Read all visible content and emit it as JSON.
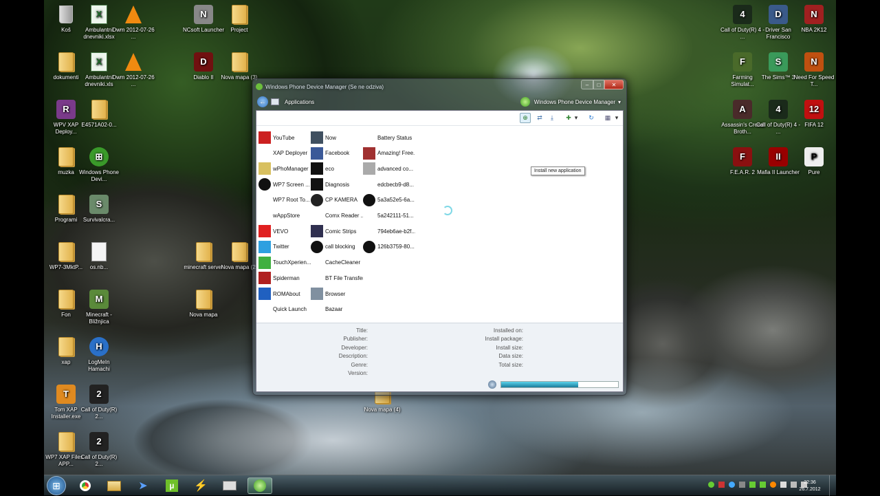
{
  "desktop_icons": [
    {
      "label": "Koš",
      "icon": "recycle-bin-icon"
    },
    {
      "label": "Ambulantni dnevniki.xlsx",
      "icon": "excel-file-icon"
    },
    {
      "label": "Dwm 2012-07-26 ...",
      "icon": "vlc-cone-icon"
    },
    {
      "label": "NCsoft Launcher",
      "icon": "ncsoft-icon"
    },
    {
      "label": "Project",
      "icon": "folder-icon"
    },
    {
      "label": "dokumenti",
      "icon": "folder-icon"
    },
    {
      "label": "Ambulantni dnevniki.xls",
      "icon": "excel-file-icon"
    },
    {
      "label": "Dwm 2012-07-26 ...",
      "icon": "vlc-cone-icon"
    },
    {
      "label": "Diablo II",
      "icon": "diablo-icon"
    },
    {
      "label": "Nova mapa (3)",
      "icon": "folder-icon"
    },
    {
      "label": "WPV XAP Deploy...",
      "icon": "winrar-icon"
    },
    {
      "label": "E4571A02-0...",
      "icon": "folder-icon"
    },
    {
      "label": "muzka",
      "icon": "folder-icon"
    },
    {
      "label": "Windows Phone Devi...",
      "icon": "windows-phone-icon"
    },
    {
      "label": "Programi",
      "icon": "folder-icon"
    },
    {
      "label": "Survivalcra...",
      "icon": "survivalcraft-icon"
    },
    {
      "label": "WP7-3MktP...",
      "icon": "folder-icon"
    },
    {
      "label": "os.nb...",
      "icon": "file-icon"
    },
    {
      "label": "minecraft server",
      "icon": "folder-icon"
    },
    {
      "label": "Nova mapa (2)",
      "icon": "folder-icon"
    },
    {
      "label": "Fon",
      "icon": "folder-icon"
    },
    {
      "label": "Minecraft - Bližnjica",
      "icon": "minecraft-icon"
    },
    {
      "label": "Nova mapa",
      "icon": "folder-icon"
    },
    {
      "label": "xap",
      "icon": "folder-icon"
    },
    {
      "label": "LogMeIn Hamachi",
      "icon": "hamachi-icon"
    },
    {
      "label": "Tom XAP Installer.exe",
      "icon": "installer-icon"
    },
    {
      "label": "Call of Duty(R) 2...",
      "icon": "cod2-icon"
    },
    {
      "label": "WP7 XAP Files - APP...",
      "icon": "folder-icon"
    },
    {
      "label": "Call of Duty(R) 2...",
      "icon": "cod2-icon"
    },
    {
      "label": "Nova mapa (4)",
      "icon": "folder-icon"
    },
    {
      "label": "Call of Duty(R) 4 - ...",
      "icon": "cod4-icon"
    },
    {
      "label": "Driver San Francisco",
      "icon": "driver-icon"
    },
    {
      "label": "NBA 2K12",
      "icon": "nba-icon"
    },
    {
      "label": "Farming Simulat...",
      "icon": "farming-icon"
    },
    {
      "label": "The Sims™ 3",
      "icon": "sims-icon"
    },
    {
      "label": "Need For Speed T...",
      "icon": "nfs-icon"
    },
    {
      "label": "Assassin's Creed Broth...",
      "icon": "assassins-icon"
    },
    {
      "label": "Call of Duty(R) 4 - ...",
      "icon": "cod4-icon"
    },
    {
      "label": "FIFA 12",
      "icon": "fifa-icon"
    },
    {
      "label": "F.E.A.R. 2",
      "icon": "fear-icon"
    },
    {
      "label": "Mafia II Launcher",
      "icon": "mafia-icon"
    },
    {
      "label": "Pure",
      "icon": "pure-icon"
    }
  ],
  "window": {
    "title": "Windows Phone Device Manager (Se ne odziva)",
    "nav_label": "Applications",
    "device_label": "Windows Phone Device Manager",
    "tooltip": "Install new application",
    "apps": [
      {
        "name": "YouTube",
        "icon": "youtube-icon",
        "color": "#cc2020"
      },
      {
        "name": "XAP Deployer",
        "icon": "blank-icon",
        "color": "#ffffff"
      },
      {
        "name": "wPhoManager",
        "icon": "wpho-icon",
        "color": "#d8c060"
      },
      {
        "name": "WP7 Screen ...",
        "icon": "screen-icon",
        "color": "#111111"
      },
      {
        "name": "WP7 Root To...",
        "icon": "blank-icon",
        "color": "#ffffff"
      },
      {
        "name": "wAppStore",
        "icon": "blank-icon",
        "color": "#ffffff"
      },
      {
        "name": "VEVO",
        "icon": "vevo-icon",
        "color": "#e02020"
      },
      {
        "name": "Twitter",
        "icon": "twitter-icon",
        "color": "#2ea0e0"
      },
      {
        "name": "TouchXperien...",
        "icon": "touchxperience-icon",
        "color": "#40b040"
      },
      {
        "name": "Spiderman",
        "icon": "spiderman-icon",
        "color": "#b02020"
      },
      {
        "name": "ROMAbout",
        "icon": "info-icon",
        "color": "#2060c0"
      },
      {
        "name": "Quick Launch",
        "icon": "blank-icon",
        "color": "#ffffff"
      },
      {
        "name": "Now",
        "icon": "now-icon",
        "color": "#405060"
      },
      {
        "name": "Facebook",
        "icon": "facebook-icon",
        "color": "#3b5998"
      },
      {
        "name": "eco",
        "icon": "eco-icon",
        "color": "#111111"
      },
      {
        "name": "Diagnosis",
        "icon": "diagnosis-icon",
        "color": "#111111"
      },
      {
        "name": "CP KAMERA",
        "icon": "camera-icon",
        "color": "#222222"
      },
      {
        "name": "Comx Reader ...",
        "icon": "blank-icon",
        "color": "#ffffff"
      },
      {
        "name": "Comic Strips",
        "icon": "comic-icon",
        "color": "#303050"
      },
      {
        "name": "call blocking",
        "icon": "call-blocking-icon",
        "color": "#111111"
      },
      {
        "name": "CacheCleaner",
        "icon": "blank-icon",
        "color": "#ffffff"
      },
      {
        "name": "BT File Transfer",
        "icon": "blank-icon",
        "color": "#ffffff"
      },
      {
        "name": "Browser",
        "icon": "browser-icon",
        "color": "#8090a0"
      },
      {
        "name": "Bazaar",
        "icon": "bazaar-icon",
        "color": "#ffffff"
      },
      {
        "name": "Battery Status",
        "icon": "blank-icon",
        "color": "#ffffff"
      },
      {
        "name": "Amazing! Free...",
        "icon": "amazing-icon",
        "color": "#a03030"
      },
      {
        "name": "advanced co...",
        "icon": "settings-gear-icon",
        "color": "#aaaaaa"
      },
      {
        "name": "edcbecb9-d8...",
        "icon": "radio-icon",
        "color": "#ffffff"
      },
      {
        "name": "5a3a52e5-6a...",
        "icon": "dark-circle-icon",
        "color": "#111111"
      },
      {
        "name": "5a242111-51...",
        "icon": "blank-icon",
        "color": "#ffffff"
      },
      {
        "name": "794eb6ae-b2f...",
        "icon": "blank-icon",
        "color": "#ffffff"
      },
      {
        "name": "126b3759-80...",
        "icon": "dark-circle-icon",
        "color": "#111111"
      }
    ],
    "details_left": [
      "Title:",
      "Publisher:",
      "Developer:",
      "Description:",
      "Genre:",
      "Version:"
    ],
    "details_right": [
      "Installed on:",
      "Install package:",
      "Install size:",
      "Data size:",
      "Total size:"
    ],
    "progress": 0.66
  },
  "tray": {
    "time": "22:36",
    "date": "26.7.2012"
  }
}
